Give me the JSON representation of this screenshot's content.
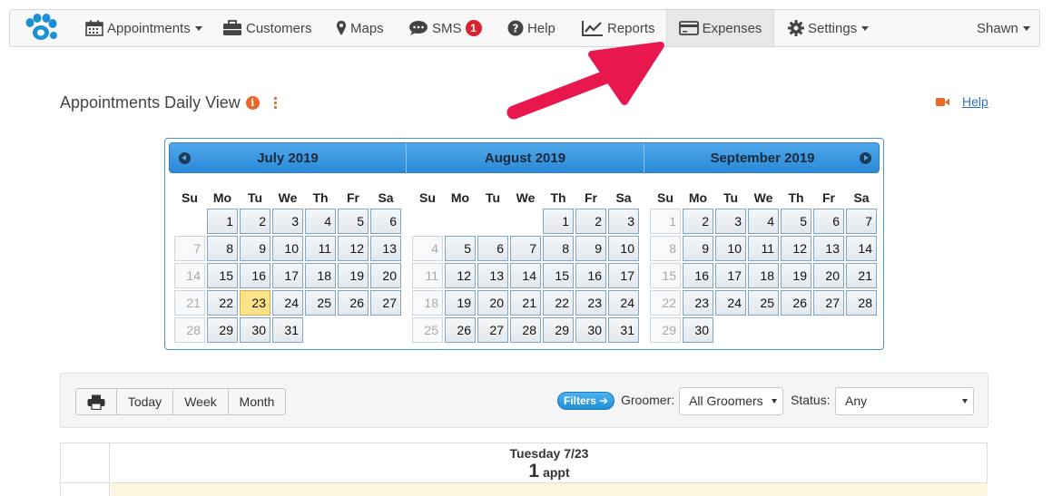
{
  "navbar": {
    "items": [
      {
        "label": "Appointments",
        "icon": "calendar-icon",
        "dropdown": true
      },
      {
        "label": "Customers",
        "icon": "briefcase-icon"
      },
      {
        "label": "Maps",
        "icon": "map-marker-icon"
      },
      {
        "label": "SMS",
        "icon": "chat-icon",
        "badge": "1"
      },
      {
        "label": "Help",
        "icon": "question-circle-icon"
      },
      {
        "label": "Reports",
        "icon": "line-chart-icon"
      },
      {
        "label": "Expenses",
        "icon": "credit-card-icon",
        "active": true
      },
      {
        "label": "Settings",
        "icon": "gear-icon",
        "dropdown": true
      }
    ],
    "user": "Shawn"
  },
  "page": {
    "title": "Appointments Daily View",
    "info_glyph": "i",
    "help_label": "Help"
  },
  "calendar": {
    "weekdays": [
      "Su",
      "Mo",
      "Tu",
      "We",
      "Th",
      "Fr",
      "Sa"
    ],
    "months": [
      {
        "title": "July 2019"
      },
      {
        "title": "August 2019"
      },
      {
        "title": "September 2019"
      }
    ],
    "selected_day": "23"
  },
  "toolbar": {
    "buttons": [
      "Today",
      "Week",
      "Month"
    ],
    "filters_label": "Filters",
    "groomer_label": "Groomer:",
    "groomer_value": "All Groomers",
    "status_label": "Status:",
    "status_value": "Any"
  },
  "day_view": {
    "day_label": "Tuesday 7/23",
    "appt_count": "1",
    "appt_label": "appt"
  },
  "colors": {
    "accent_blue": "#2a8ad8",
    "today_highlight": "#fbe288",
    "annotation_arrow": "#e8184f",
    "sms_badge": "#d9232e"
  }
}
